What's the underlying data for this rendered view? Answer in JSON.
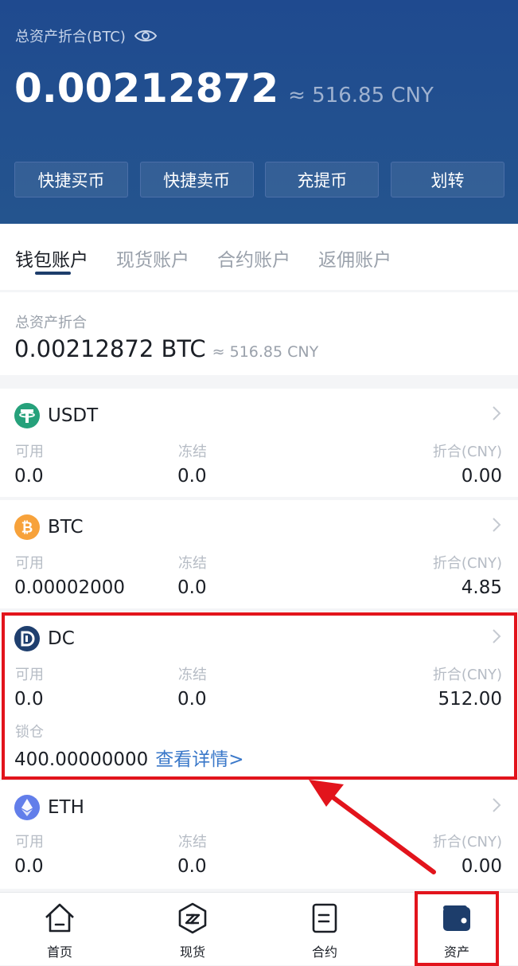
{
  "header": {
    "total_label": "总资产折合(BTC)",
    "total_btc": "0.00212872",
    "total_cny": "≈ 516.85 CNY",
    "quick_buttons": [
      "快捷买币",
      "快捷卖币",
      "充提币",
      "划转"
    ]
  },
  "tabs": [
    "钱包账户",
    "现货账户",
    "合约账户",
    "返佣账户"
  ],
  "active_tab": 0,
  "summary": {
    "label": "总资产折合",
    "btc": "0.00212872 BTC",
    "cny": "≈ 516.85 CNY"
  },
  "columns": {
    "available": "可用",
    "frozen": "冻结",
    "converted": "折合(CNY)",
    "locked": "锁仓"
  },
  "assets": [
    {
      "name": "USDT",
      "icon": "tether-icon",
      "color": "#26a17b",
      "available": "0.0",
      "frozen": "0.0",
      "cny": "0.00"
    },
    {
      "name": "BTC",
      "icon": "bitcoin-icon",
      "color": "#f7a23b",
      "available": "0.00002000",
      "frozen": "0.0",
      "cny": "4.85"
    },
    {
      "name": "DC",
      "icon": "dc-coin-icon",
      "color": "#1f3f6e",
      "available": "0.0",
      "frozen": "0.0",
      "cny": "512.00",
      "locked": "400.00000000",
      "detail_link": "查看详情>"
    },
    {
      "name": "ETH",
      "icon": "ethereum-icon",
      "color": "#627eea",
      "available": "0.0",
      "frozen": "0.0",
      "cny": "0.00"
    }
  ],
  "bottom_nav": [
    "首页",
    "现货",
    "合约",
    "资产"
  ],
  "active_nav": 3,
  "colors": {
    "header_bg": "#22508f",
    "accent": "#1d3d6b",
    "link": "#3a78c9",
    "annotation_red": "#e2141c"
  }
}
